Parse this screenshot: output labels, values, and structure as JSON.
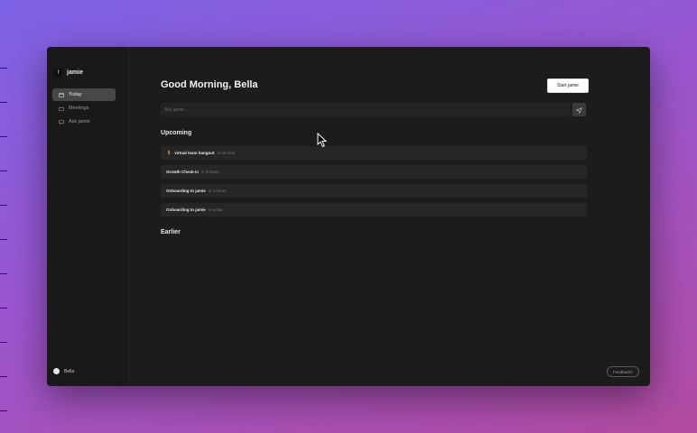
{
  "app": {
    "name": "jamie",
    "logo_glyph": "f"
  },
  "sidebar": {
    "items": [
      {
        "label": "Today",
        "icon": "calendar-icon",
        "active": true
      },
      {
        "label": "Meetings",
        "icon": "folder-icon",
        "active": false
      },
      {
        "label": "Ask jamie",
        "icon": "chat-icon",
        "active": false
      }
    ],
    "user": {
      "name": "Bella"
    }
  },
  "main": {
    "greeting": "Good Morning, Bella",
    "start_button": "Start jamie",
    "ask": {
      "placeholder": "Ask jamie...",
      "value": "",
      "send_icon": "send-icon"
    },
    "upcoming_title": "Upcoming",
    "earlier_title": "Earlier",
    "upcoming": [
      {
        "emoji": "🧍",
        "title": "virtual team hangout",
        "time": "in an hour"
      },
      {
        "emoji": "",
        "title": "Growth Check-in",
        "time": "in 3 hours"
      },
      {
        "emoji": "",
        "title": "Onboarding to jamie",
        "time": "in 3 hours"
      },
      {
        "emoji": "",
        "title": "Onboarding to jamie",
        "time": "in a day"
      }
    ]
  },
  "feedback_button": "Feedback?",
  "colors": {
    "background_start": "#7d63e6",
    "background_end": "#b24aa0",
    "window": "#1c1c1c",
    "active_nav": "#474747"
  }
}
